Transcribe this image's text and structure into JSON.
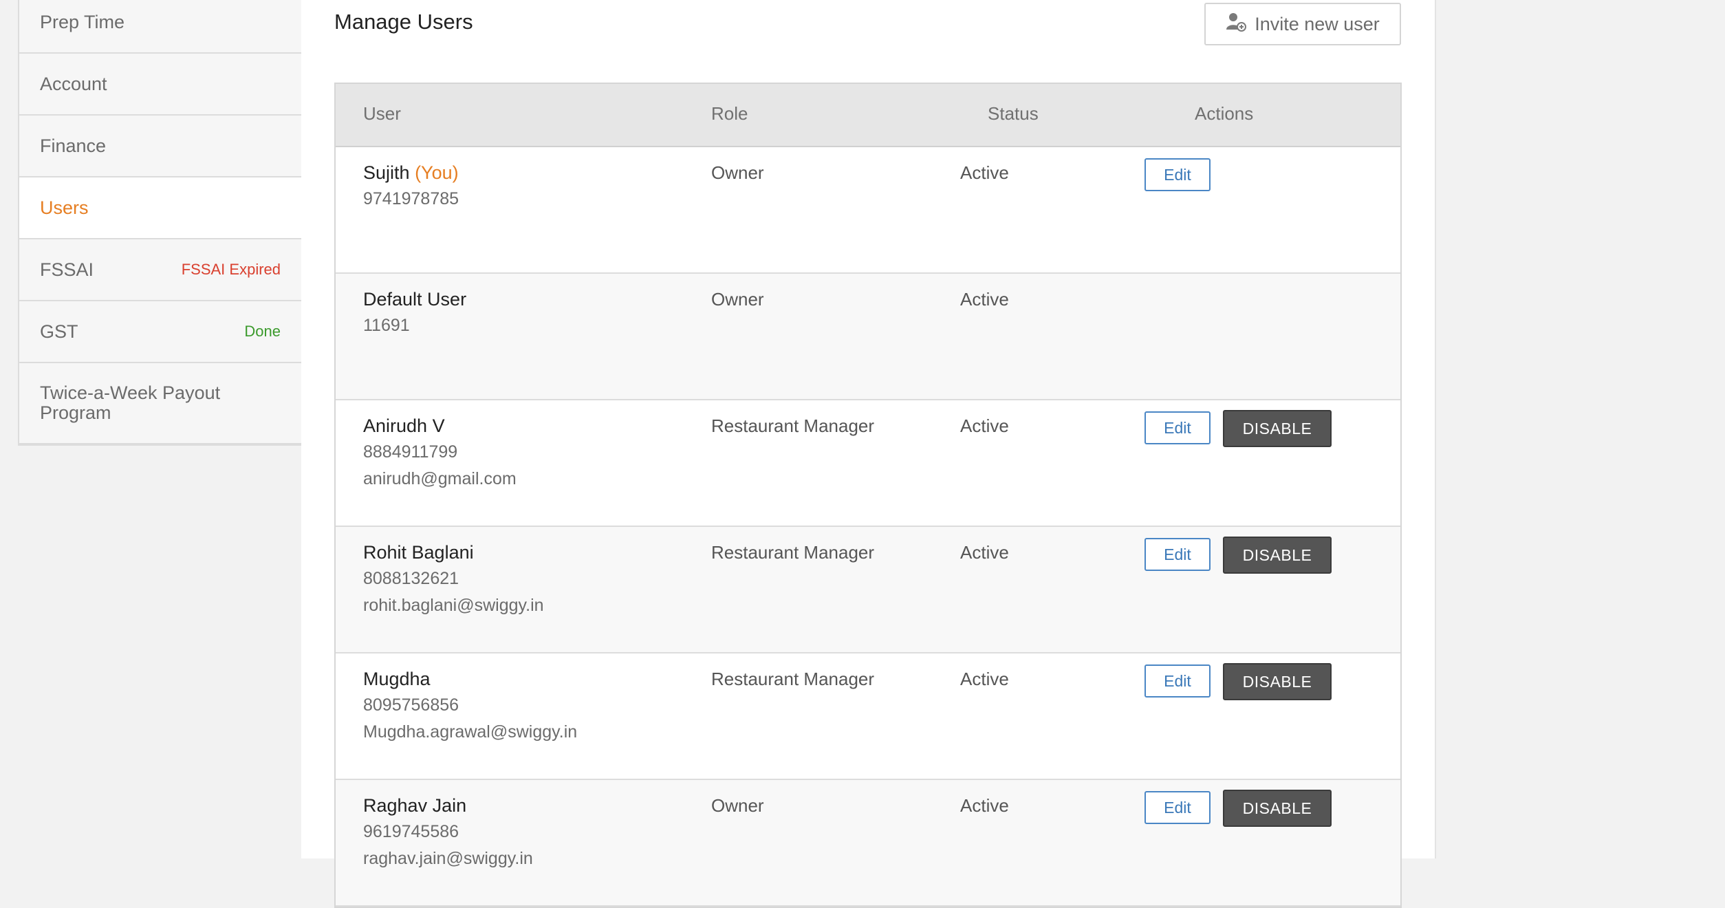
{
  "sidebar": {
    "items": [
      {
        "label": "Prep Time"
      },
      {
        "label": "Account"
      },
      {
        "label": "Finance"
      },
      {
        "label": "Users",
        "active": true
      },
      {
        "label": "FSSAI",
        "badge": "FSSAI Expired"
      },
      {
        "label": "GST",
        "badge": "Done"
      },
      {
        "label": "Twice-a-Week Payout Program"
      }
    ]
  },
  "main": {
    "title": "Manage Users",
    "invite_button": "Invite new user",
    "table": {
      "headers": {
        "user": "User",
        "role": "Role",
        "status": "Status",
        "actions": "Actions"
      },
      "rows": [
        {
          "name": "Sujith",
          "you": "(You)",
          "phone": "9741978785",
          "email": "",
          "role": "Owner",
          "status": "Active",
          "edit": "Edit",
          "disable": ""
        },
        {
          "name": "Default User",
          "you": "",
          "phone": "11691",
          "email": "",
          "role": "Owner",
          "status": "Active",
          "edit": "",
          "disable": ""
        },
        {
          "name": "Anirudh V",
          "you": "",
          "phone": "8884911799",
          "email": "anirudh@gmail.com",
          "role": "Restaurant Manager",
          "status": "Active",
          "edit": "Edit",
          "disable": "DISABLE"
        },
        {
          "name": "Rohit Baglani",
          "you": "",
          "phone": "8088132621",
          "email": "rohit.baglani@swiggy.in",
          "role": "Restaurant Manager",
          "status": "Active",
          "edit": "Edit",
          "disable": "DISABLE"
        },
        {
          "name": "Mugdha",
          "you": "",
          "phone": "8095756856",
          "email": "Mugdha.agrawal@swiggy.in",
          "role": "Restaurant Manager",
          "status": "Active",
          "edit": "Edit",
          "disable": "DISABLE"
        },
        {
          "name": "Raghav Jain",
          "you": "",
          "phone": "9619745586",
          "email": "raghav.jain@swiggy.in",
          "role": "Owner",
          "status": "Active",
          "edit": "Edit",
          "disable": "DISABLE"
        }
      ]
    }
  },
  "colors": {
    "accent": "#e67e22",
    "expired": "#d9402f",
    "done": "#3b9a2c",
    "edit_blue": "#3a78b8",
    "disable_bg": "#555555"
  },
  "icons": {
    "invite": "add-user-icon"
  }
}
